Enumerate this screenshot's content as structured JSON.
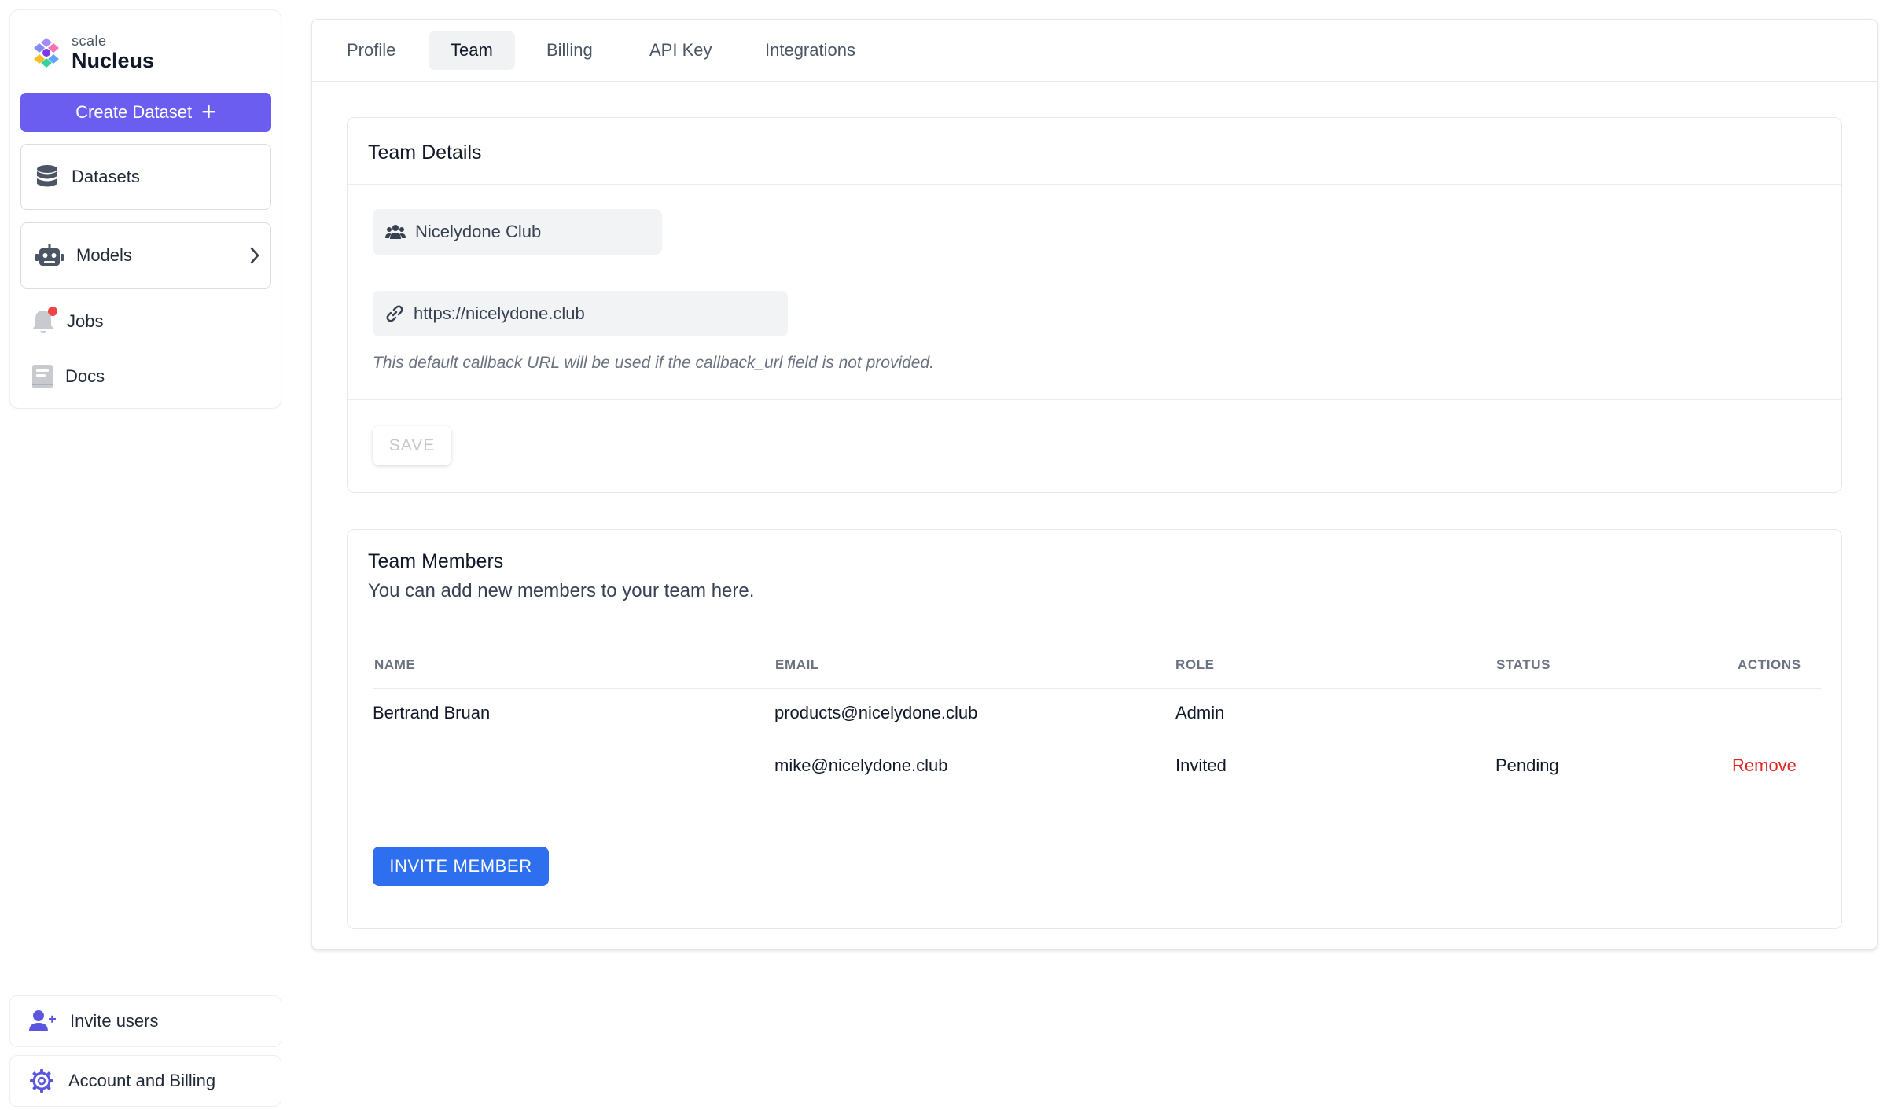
{
  "brand": {
    "small": "scale",
    "name": "Nucleus"
  },
  "sidebar": {
    "create_label": "Create Dataset",
    "items": [
      {
        "label": "Datasets",
        "icon": "database-icon"
      },
      {
        "label": "Models",
        "icon": "robot-icon"
      },
      {
        "label": "Jobs",
        "icon": "bell-icon"
      },
      {
        "label": "Docs",
        "icon": "book-icon"
      }
    ],
    "bottom": [
      {
        "label": "Invite users",
        "icon": "user-plus-icon"
      },
      {
        "label": "Account and Billing",
        "icon": "gear-icon"
      }
    ]
  },
  "tabs": [
    {
      "label": "Profile",
      "active": false
    },
    {
      "label": "Team",
      "active": true
    },
    {
      "label": "Billing",
      "active": false
    },
    {
      "label": "API Key",
      "active": false
    },
    {
      "label": "Integrations",
      "active": false
    }
  ],
  "team_details": {
    "title": "Team Details",
    "team_name": "Nicelydone Club",
    "callback_url": "https://nicelydone.club",
    "hint": "This default callback URL will be used if the callback_url field is not provided.",
    "save_label": "SAVE"
  },
  "team_members": {
    "title": "Team Members",
    "subtitle": "You can add new members to your team here.",
    "columns": [
      "NAME",
      "EMAIL",
      "ROLE",
      "STATUS",
      "ACTIONS"
    ],
    "rows": [
      {
        "name": "Bertrand Bruan",
        "email": "products@nicelydone.club",
        "role": "Admin",
        "status": "",
        "action": ""
      },
      {
        "name": "",
        "email": "mike@nicelydone.club",
        "role": "Invited",
        "status": "Pending",
        "action": "Remove"
      }
    ],
    "invite_label": "INVITE MEMBER"
  },
  "colors": {
    "primary": "#6a5df0",
    "invite": "#2e6ff0",
    "remove": "#dc2626",
    "notification": "#ef4444",
    "icon_gray": "#4b5563",
    "icon_light": "#c8cacf"
  }
}
